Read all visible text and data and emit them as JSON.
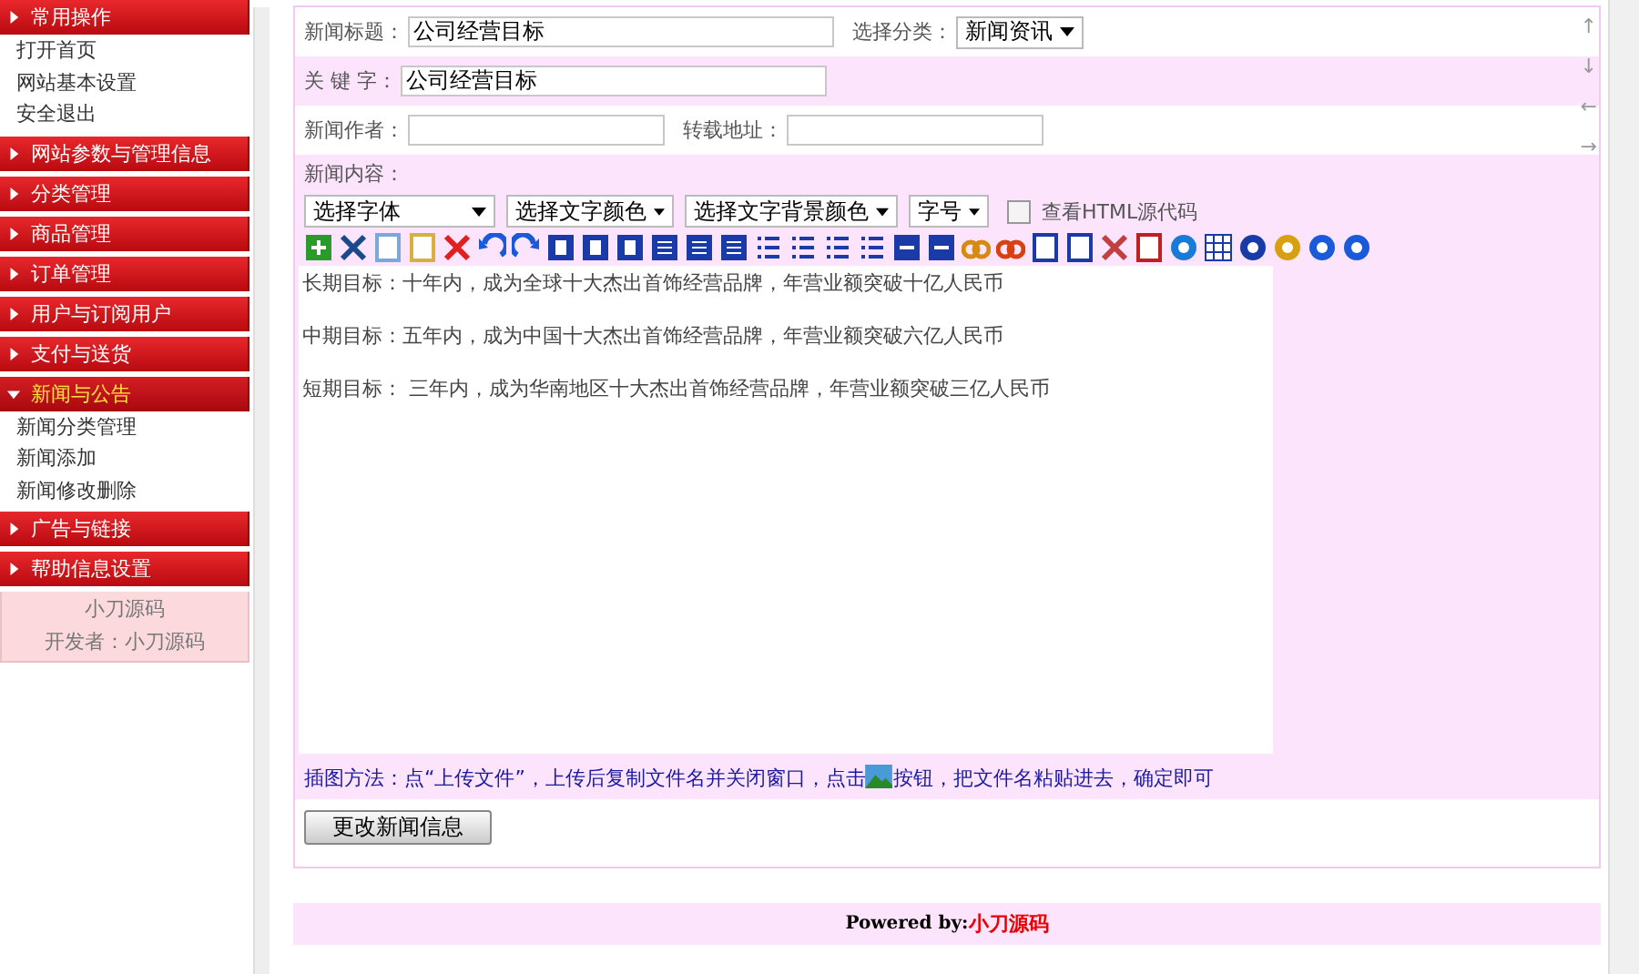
{
  "sidebar": {
    "sections": [
      {
        "title": "常用操作",
        "selected": false,
        "items": [
          "打开首页",
          "网站基本设置",
          "安全退出"
        ]
      },
      {
        "title": "网站参数与管理信息",
        "selected": false
      },
      {
        "title": "分类管理",
        "selected": false
      },
      {
        "title": "商品管理",
        "selected": false
      },
      {
        "title": "订单管理",
        "selected": false
      },
      {
        "title": "用户与订阅用户",
        "selected": false
      },
      {
        "title": "支付与送货",
        "selected": false
      },
      {
        "title": "新闻与公告",
        "selected": true,
        "items": [
          "新闻分类管理",
          "新闻添加",
          "新闻修改删除"
        ]
      },
      {
        "title": "广告与链接",
        "selected": false
      },
      {
        "title": "帮助信息设置",
        "selected": false
      }
    ],
    "footer": [
      "小刀源码",
      "开发者：小刀源码"
    ]
  },
  "form": {
    "title": {
      "label": "新闻标题：",
      "value": "公司经营目标"
    },
    "category": {
      "label": "选择分类：",
      "value": "新闻资讯"
    },
    "keywords": {
      "label": "关 键 字：",
      "value": "公司经营目标"
    },
    "author": {
      "label": "新闻作者："
    },
    "source": {
      "label": "转载地址："
    },
    "content": {
      "label": "新闻内容："
    },
    "editor_selects": [
      "选择字体",
      "选择文字颜色",
      "选择文字背景颜色",
      "字号"
    ],
    "html_source": {
      "label": "查看HTML源代码",
      "checked": false
    },
    "editor_paragraphs": [
      "长期目标：十年内，成为全球十大杰出首饰经营品牌，年营业额突破十亿人民币",
      "中期目标：五年内，成为中国十大杰出首饰经营品牌，年营业额突破六亿人民币",
      "短期目标：  三年内，成为华南地区十大杰出首饰经营品牌，年营业额突破三亿人民币"
    ],
    "hint_before": "插图方法：点“上传文件”，上传后复制文件名并关闭窗口，点击",
    "hint_after": "按钮，把文件名粘贴进去，确定即可",
    "submit": "更改新闻信息"
  },
  "scroll_arrows": [
    "↑",
    "↓",
    "←",
    "→"
  ],
  "footer": {
    "prefix": "Powered by:",
    "brand": "小刀源码"
  }
}
